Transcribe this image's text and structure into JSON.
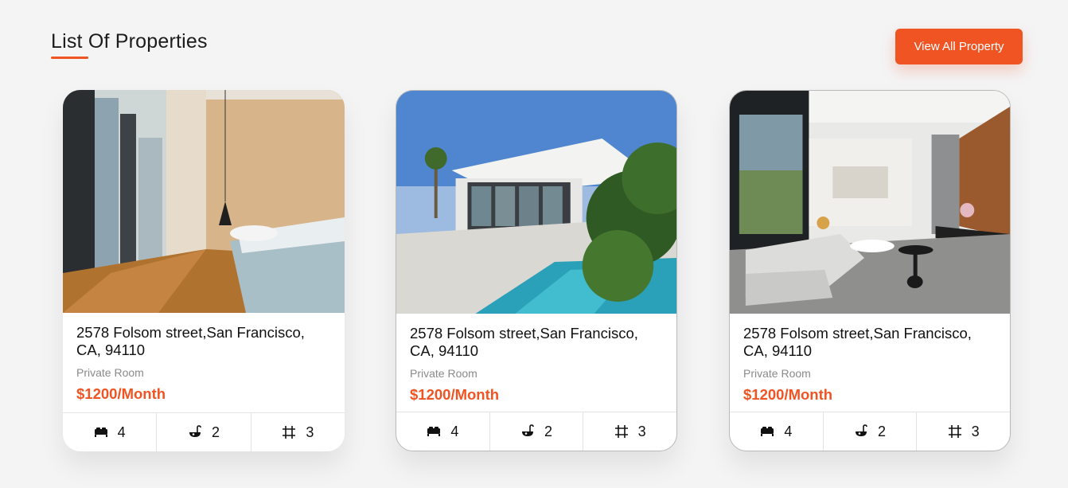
{
  "header": {
    "title": "List Of Properties",
    "view_all_label": "View All Property"
  },
  "colors": {
    "accent": "#f05423",
    "background": "#f4f4f5"
  },
  "properties": [
    {
      "image": "bedroom-photo",
      "address": "2578 Folsom street,San Francisco, CA, 94110",
      "room_type": "Private Room",
      "price": "$1200/Month",
      "features": [
        {
          "icon": "bed-icon",
          "value": "4"
        },
        {
          "icon": "bathtub-icon",
          "value": "2"
        },
        {
          "icon": "area-grid-icon",
          "value": "3"
        }
      ]
    },
    {
      "image": "villa-pool-photo",
      "address": "2578 Folsom street,San Francisco, CA, 94110",
      "room_type": "Private Room",
      "price": "$1200/Month",
      "features": [
        {
          "icon": "bed-icon",
          "value": "4"
        },
        {
          "icon": "bathtub-icon",
          "value": "2"
        },
        {
          "icon": "area-grid-icon",
          "value": "3"
        }
      ]
    },
    {
      "image": "living-room-photo",
      "address": "2578 Folsom street,San Francisco, CA, 94110",
      "room_type": "Private Room",
      "price": "$1200/Month",
      "features": [
        {
          "icon": "bed-icon",
          "value": "4"
        },
        {
          "icon": "bathtub-icon",
          "value": "2"
        },
        {
          "icon": "area-grid-icon",
          "value": "3"
        }
      ]
    }
  ]
}
